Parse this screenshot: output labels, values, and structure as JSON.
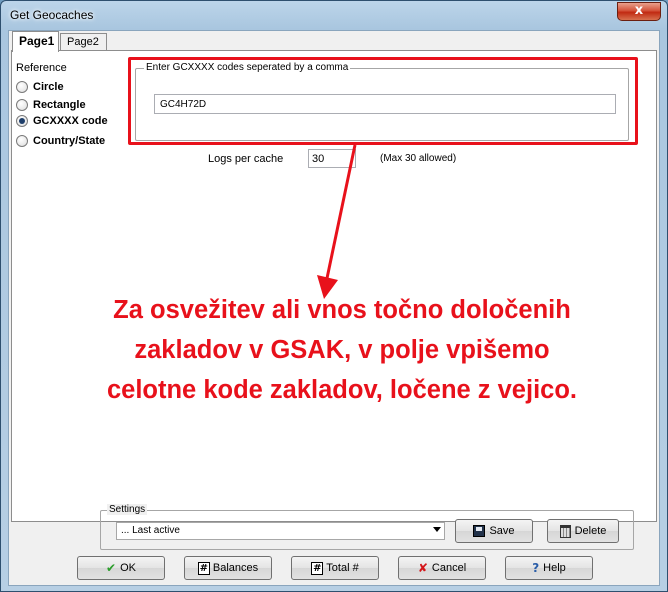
{
  "window": {
    "title": "Get Geocaches",
    "close_glyph": "x"
  },
  "tabs": [
    {
      "label": "Page1",
      "active": true
    },
    {
      "label": "Page2",
      "active": false
    }
  ],
  "reference": {
    "label": "Reference",
    "options": [
      {
        "label": "Circle",
        "checked": false
      },
      {
        "label": "Rectangle",
        "checked": false
      },
      {
        "label": "GCXXXX code",
        "checked": true
      },
      {
        "label": "Country/State",
        "checked": false
      }
    ]
  },
  "codes": {
    "group_label": "Enter GCXXXX codes seperated by a comma",
    "value": "GC4H72D"
  },
  "logs": {
    "label": "Logs per cache",
    "value": "30",
    "max_note": "(Max 30 allowed)"
  },
  "annotation": {
    "lines": [
      "Za osvežitev ali vnos točno določenih",
      "zakladov v GSAK, v polje vpišemo",
      "celotne kode zakladov, ločene z vejico."
    ],
    "color": "#e8111b"
  },
  "settings": {
    "label": "Settings",
    "selected": "... Last active",
    "save_label": "Save",
    "delete_label": "Delete"
  },
  "buttons": {
    "ok": "OK",
    "balances": "Balances",
    "total": "Total #",
    "cancel": "Cancel",
    "help": "Help"
  }
}
